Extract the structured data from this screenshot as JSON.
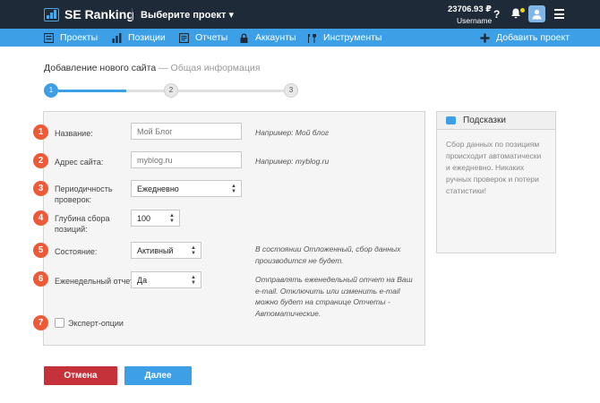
{
  "header": {
    "logo_text": "SE Ranking",
    "project_select": "Выберите проект ▾",
    "balance": "23706.93 ₽",
    "username": "Username",
    "help_label": "?"
  },
  "nav": {
    "items": [
      "Проекты",
      "Позиции",
      "Отчеты",
      "Аккаунты",
      "Инструменты"
    ],
    "add_project": "Добавить проект"
  },
  "breadcrumb": {
    "title": "Добавление нового сайта",
    "separator": " — ",
    "subtitle": "Общая информация"
  },
  "steps": [
    "1",
    "2",
    "3"
  ],
  "form": {
    "fields": [
      {
        "num": "1",
        "label": "Название:",
        "placeholder": "Мой Блог",
        "hint": "Например: Мой блог"
      },
      {
        "num": "2",
        "label": "Адрес сайта:",
        "placeholder": "myblog.ru",
        "hint": "Например: myblog.ru"
      },
      {
        "num": "3",
        "label": "Периодичность проверок:",
        "value": "Ежедневно"
      },
      {
        "num": "4",
        "label": "Глубина сбора позиций:",
        "value": "100"
      },
      {
        "num": "5",
        "label": "Состояние:",
        "value": "Активный",
        "hint": "В состоянии Отложенный, сбор данных производится не будет."
      },
      {
        "num": "6",
        "label": "Еженедельный отчет:",
        "value": "Да",
        "hint": "Отправлять еженедельный отчет на Ваш e-mail. Отключить или изменить e-mail можно будет на странице Отчеты - Автоматические."
      },
      {
        "num": "7",
        "label": "Эксперт-опции"
      }
    ]
  },
  "tips": {
    "title": "Подсказки",
    "body": "Сбор данных по позициям происходит автоматически и ежедневно. Никаких ручных проверок и потери статистики!"
  },
  "buttons": {
    "cancel": "Отмена",
    "next": "Далее"
  },
  "colors": {
    "topbar": "#1f2a38",
    "navbar": "#3d9fe6",
    "badge": "#ee5a37",
    "cancel": "#c6323a"
  }
}
